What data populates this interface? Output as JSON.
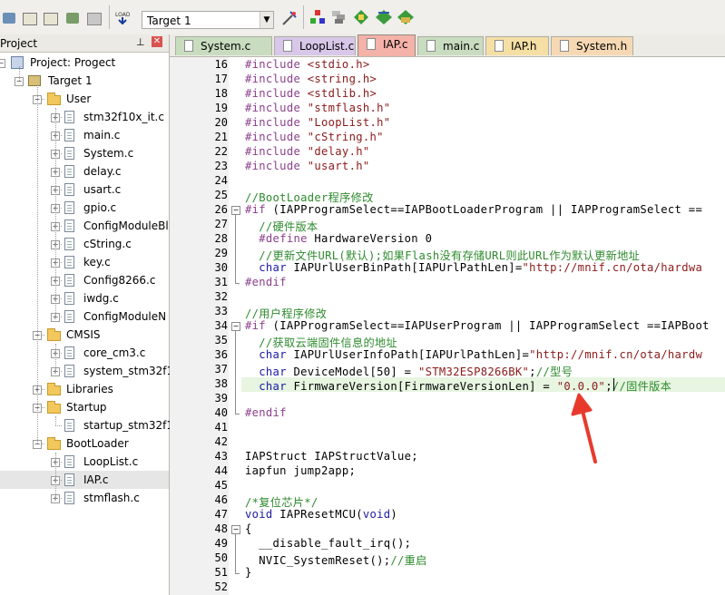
{
  "toolbar": {
    "target_select_value": "Target 1",
    "icons": [
      "translate-icon",
      "build-icon",
      "rebuild-icon",
      "batch-build-icon",
      "stop-build-icon",
      "download-icon",
      "target-options-icon",
      "manage-components-icon",
      "file-extensions-icon",
      "pack-installer-icon",
      "select-packs-icon",
      "run-time-env-icon"
    ]
  },
  "project_panel": {
    "title": "Project",
    "pin": "ᵖ",
    "tree": {
      "root": "Project: Progect",
      "target": "Target 1",
      "groups": [
        {
          "name": "User",
          "files": [
            "stm32f10x_it.c",
            "main.c",
            "System.c",
            "delay.c",
            "usart.c",
            "gpio.c",
            "ConfigModuleBl",
            "cString.c",
            "key.c",
            "Config8266.c",
            "iwdg.c",
            "ConfigModuleN"
          ]
        },
        {
          "name": "CMSIS",
          "files": [
            "core_cm3.c",
            "system_stm32f10"
          ]
        },
        {
          "name": "Libraries",
          "files": []
        },
        {
          "name": "Startup",
          "files": [
            "startup_stm32f10"
          ]
        },
        {
          "name": "BootLoader",
          "files": [
            "LoopList.c",
            "IAP.c",
            "stmflash.c"
          ]
        }
      ]
    }
  },
  "tabs": [
    {
      "label": "System.c",
      "color": "#c9dcc0",
      "active": false
    },
    {
      "label": "LoopList.c",
      "color": "#d8c7e9",
      "active": false
    },
    {
      "label": "IAP.c",
      "color": "#f4b2a8",
      "active": true
    },
    {
      "label": "main.c",
      "color": "#c9dcc0",
      "active": false
    },
    {
      "label": "IAP.h",
      "color": "#f5dfa4",
      "active": false
    },
    {
      "label": "System.h",
      "color": "#f6d9b4",
      "active": false
    }
  ],
  "editor": {
    "lines": [
      {
        "n": "16",
        "text": "#include <stdio.h>"
      },
      {
        "n": "17",
        "text": "#include <string.h>"
      },
      {
        "n": "18",
        "text": "#include <stdlib.h>"
      },
      {
        "n": "19",
        "text": "#include \"stmflash.h\""
      },
      {
        "n": "20",
        "text": "#include \"LoopList.h\""
      },
      {
        "n": "21",
        "text": "#include \"cString.h\""
      },
      {
        "n": "22",
        "text": "#include \"delay.h\""
      },
      {
        "n": "23",
        "text": "#include \"usart.h\""
      },
      {
        "n": "24",
        "text": ""
      },
      {
        "n": "25",
        "text": "//BootLoader程序修改"
      },
      {
        "n": "26",
        "text": "#if (IAPProgramSelect==IAPBootLoaderProgram || IAPProgramSelect =="
      },
      {
        "n": "27",
        "text": "  //硬件版本"
      },
      {
        "n": "28",
        "text": "  #define HardwareVersion 0"
      },
      {
        "n": "29",
        "text": "  //更新文件URL(默认);如果Flash没有存储URL则此URL作为默认更新地址"
      },
      {
        "n": "30",
        "text": "  char IAPUrlUserBinPath[IAPUrlPathLen]=\"http://mnif.cn/ota/hardwa"
      },
      {
        "n": "31",
        "text": "#endif"
      },
      {
        "n": "32",
        "text": ""
      },
      {
        "n": "33",
        "text": "//用户程序修改"
      },
      {
        "n": "34",
        "text": "#if (IAPProgramSelect==IAPUserProgram || IAPProgramSelect ==IAPBoot"
      },
      {
        "n": "35",
        "text": "  //获取云端固件信息的地址"
      },
      {
        "n": "36",
        "text": "  char IAPUrlUserInfoPath[IAPUrlPathLen]=\"http://mnif.cn/ota/hardw"
      },
      {
        "n": "37",
        "text": "  char DeviceModel[50] = \"STM32ESP8266BK\";//型号"
      },
      {
        "n": "38",
        "text": "  char FirmwareVersion[FirmwareVersionLen] = \"0.0.0\";//固件版本"
      },
      {
        "n": "39",
        "text": ""
      },
      {
        "n": "40",
        "text": "#endif"
      },
      {
        "n": "41",
        "text": ""
      },
      {
        "n": "42",
        "text": ""
      },
      {
        "n": "43",
        "text": "IAPStruct IAPStructValue;"
      },
      {
        "n": "44",
        "text": "iapfun jump2app;"
      },
      {
        "n": "45",
        "text": ""
      },
      {
        "n": "46",
        "text": "/*复位芯片*/"
      },
      {
        "n": "47",
        "text": "void IAPResetMCU(void)"
      },
      {
        "n": "48",
        "text": "{"
      },
      {
        "n": "49",
        "text": "  __disable_fault_irq();"
      },
      {
        "n": "50",
        "text": "  NVIC_SystemReset();//重启"
      },
      {
        "n": "51",
        "text": "}"
      },
      {
        "n": "52",
        "text": ""
      }
    ],
    "highlighted_line": "38"
  },
  "colors": {
    "preprocessor": "#8b3f8b",
    "string": "#8b1a1a",
    "comment": "#2e8b2e",
    "keyword": "#1a1aa6",
    "current_line": "#e7f5e1",
    "annotation_arrow": "#e83a2c"
  }
}
